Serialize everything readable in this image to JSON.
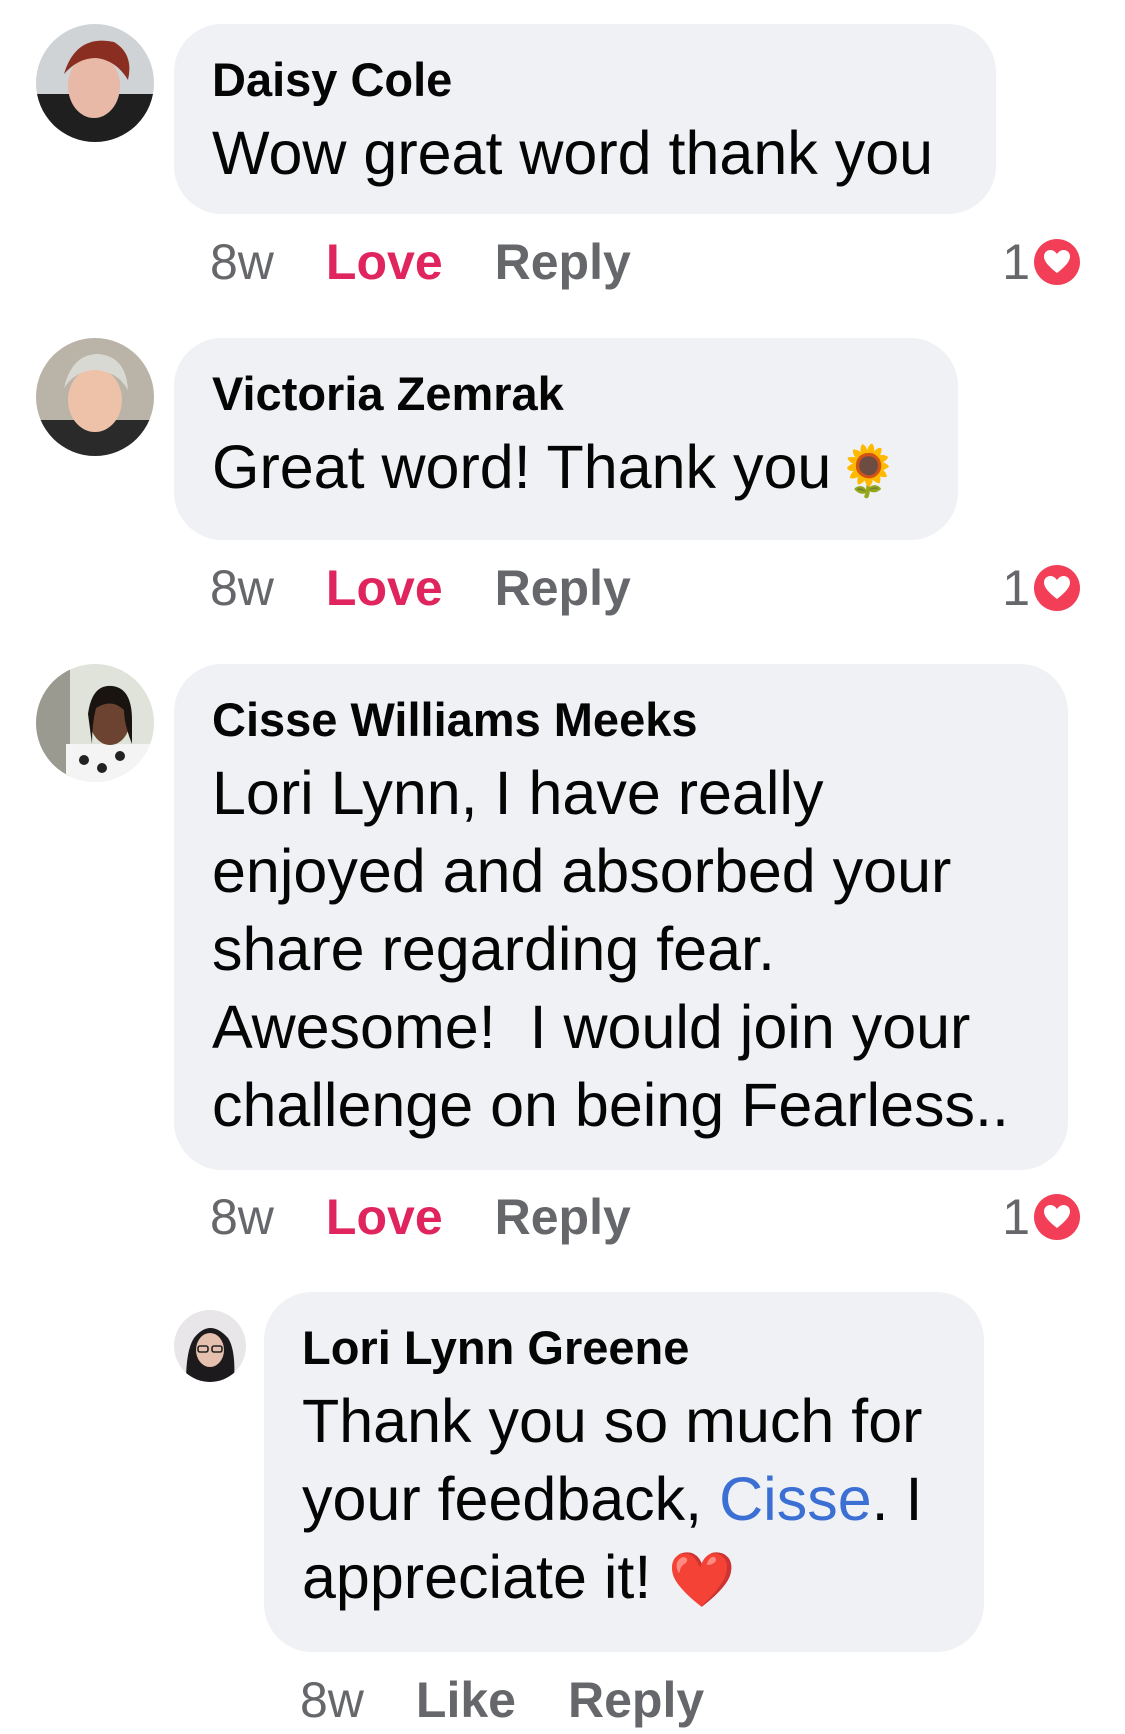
{
  "comments": [
    {
      "author": "Daisy Cole",
      "text": "Wow great word thank you",
      "time": "8w",
      "reaction_action": "Love",
      "reply_label": "Reply",
      "reaction_count": "1",
      "reaction_icon": "heart-icon"
    },
    {
      "author": "Victoria Zemrak",
      "text": "Great word! Thank you",
      "emoji": "🌻",
      "time": "8w",
      "reaction_action": "Love",
      "reply_label": "Reply",
      "reaction_count": "1",
      "reaction_icon": "heart-icon"
    },
    {
      "author": "Cisse Williams Meeks",
      "text_lines": [
        "Lori Lynn, I have really",
        "enjoyed and absorbed your",
        "share regarding fear.",
        "Awesome!  I would join your",
        "challenge on being Fearless.."
      ],
      "time": "8w",
      "reaction_action": "Love",
      "reply_label": "Reply",
      "reaction_count": "1",
      "reaction_icon": "heart-icon"
    }
  ],
  "reply": {
    "author": "Lori Lynn Greene",
    "line1": "Thank you so much for",
    "line2_before": "your feedback, ",
    "mention": "Cisse",
    "line2_after": ". I",
    "line3": "appreciate it! ",
    "emoji": "❤️",
    "time": "8w",
    "like_label": "Like",
    "reply_label": "Reply"
  },
  "colors": {
    "bubble": "#eff1f4",
    "love": "#e0245e",
    "mention": "#3b6fd4",
    "meta": "#65676b",
    "heart_badge": "#f33e58"
  }
}
